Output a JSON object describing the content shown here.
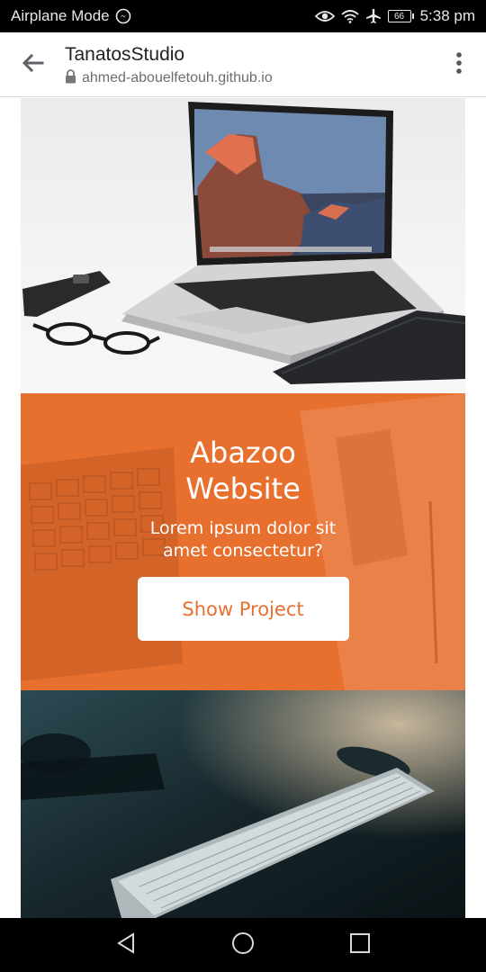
{
  "status_bar": {
    "airplane_mode_label": "Airplane Mode",
    "battery_level": "66",
    "time": "5:38 pm",
    "icons": [
      "messenger-icon",
      "eye-icon",
      "wifi-icon",
      "airplane-icon",
      "battery-icon"
    ]
  },
  "browser": {
    "page_title": "TanatosStudio",
    "url": "ahmed-abouelfetouh.github.io",
    "icons": [
      "back-arrow-icon",
      "lock-icon",
      "more-vert-icon"
    ]
  },
  "promo": {
    "title": "Abazoo Website",
    "description": "Lorem ipsum dolor sit amet consectetur?",
    "button_label": "Show Project",
    "accent_color": "#e8702f"
  },
  "nav_bar": {
    "icons": [
      "back-triangle-icon",
      "home-circle-icon",
      "recents-square-icon"
    ]
  }
}
